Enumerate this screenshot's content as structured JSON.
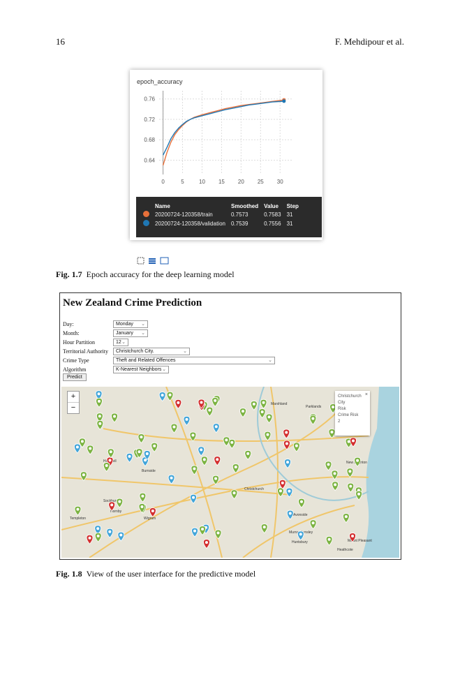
{
  "page": {
    "number": "16",
    "running_head": "F. Mehdipour et al."
  },
  "fig17": {
    "caption_label": "Fig. 1.7",
    "caption_text": "Epoch accuracy for the deep learning model",
    "chart_data": {
      "type": "line",
      "title": "epoch_accuracy",
      "x_ticks": [
        0,
        5,
        10,
        15,
        20,
        25,
        30
      ],
      "y_ticks": [
        0.64,
        0.68,
        0.72,
        0.76
      ],
      "xlim": [
        -1,
        33
      ],
      "ylim": [
        0.612,
        0.776
      ],
      "grid": true,
      "series": [
        {
          "name": "20200724-120358/train",
          "color": "#e8703a",
          "x": [
            0,
            1,
            2,
            3,
            4,
            5,
            6,
            7,
            8,
            10,
            12,
            14,
            16,
            18,
            20,
            22,
            24,
            26,
            28,
            30,
            31
          ],
          "y": [
            0.63,
            0.655,
            0.675,
            0.69,
            0.7,
            0.708,
            0.715,
            0.72,
            0.724,
            0.729,
            0.733,
            0.737,
            0.741,
            0.744,
            0.747,
            0.749,
            0.751,
            0.753,
            0.755,
            0.757,
            0.758
          ]
        },
        {
          "name": "20200724-120358/validation",
          "color": "#1f77b4",
          "x": [
            0,
            1,
            2,
            3,
            4,
            5,
            6,
            7,
            8,
            10,
            12,
            14,
            16,
            18,
            20,
            22,
            24,
            26,
            28,
            30,
            31
          ],
          "y": [
            0.65,
            0.665,
            0.682,
            0.694,
            0.703,
            0.71,
            0.716,
            0.72,
            0.723,
            0.727,
            0.731,
            0.735,
            0.739,
            0.742,
            0.745,
            0.748,
            0.75,
            0.752,
            0.754,
            0.755,
            0.7556
          ]
        }
      ]
    },
    "tooltip": {
      "headers": [
        "Name",
        "Smoothed",
        "Value",
        "Step"
      ],
      "rows": [
        {
          "color": "#e8703a",
          "name": "20200724-120358/train",
          "smoothed": "0.7573",
          "value": "0.7583",
          "step": "31"
        },
        {
          "color": "#1f77b4",
          "name": "20200724-120358/validation",
          "smoothed": "0.7539",
          "value": "0.7556",
          "step": "31"
        }
      ]
    },
    "toolbar_icons": [
      "fit-icon",
      "list-icon",
      "image-icon"
    ]
  },
  "fig18": {
    "caption_label": "Fig. 1.8",
    "caption_text": "View of the user interface for the predictive model",
    "app_title": "New Zealand Crime Prediction",
    "form": [
      {
        "label": "Day:",
        "value": "Monday"
      },
      {
        "label": "Month:",
        "value": "January"
      },
      {
        "label": "Hour Partition",
        "value": "12"
      },
      {
        "label": "Territorial Authority",
        "value": "Christchurch City."
      },
      {
        "label": "Crime Type",
        "value": "Theft and Related Offences"
      },
      {
        "label": "Algorithm",
        "value": "K-Nearest Neighbors"
      }
    ],
    "predict_label": "Predict",
    "zoom_in": "+",
    "zoom_out": "−",
    "popup_lines": [
      "Christchurch",
      "City",
      "Risk",
      "Crime Risk",
      "2"
    ],
    "popup_close": "×",
    "colors": {
      "low": "#7cb342",
      "medium": "#42a5d9",
      "high": "#d32f2f",
      "water": "#a9d3df"
    },
    "map_labels": [
      "Marshland",
      "Parklands",
      "New Brighton",
      "Hornby",
      "Wigram",
      "Halswell",
      "Huntsbury",
      "Murray Aynsley",
      "Avonside",
      "Christchurch",
      "Sockburn",
      "Burnside",
      "Templeton",
      "Mount Pleasant",
      "Heathcote"
    ]
  }
}
